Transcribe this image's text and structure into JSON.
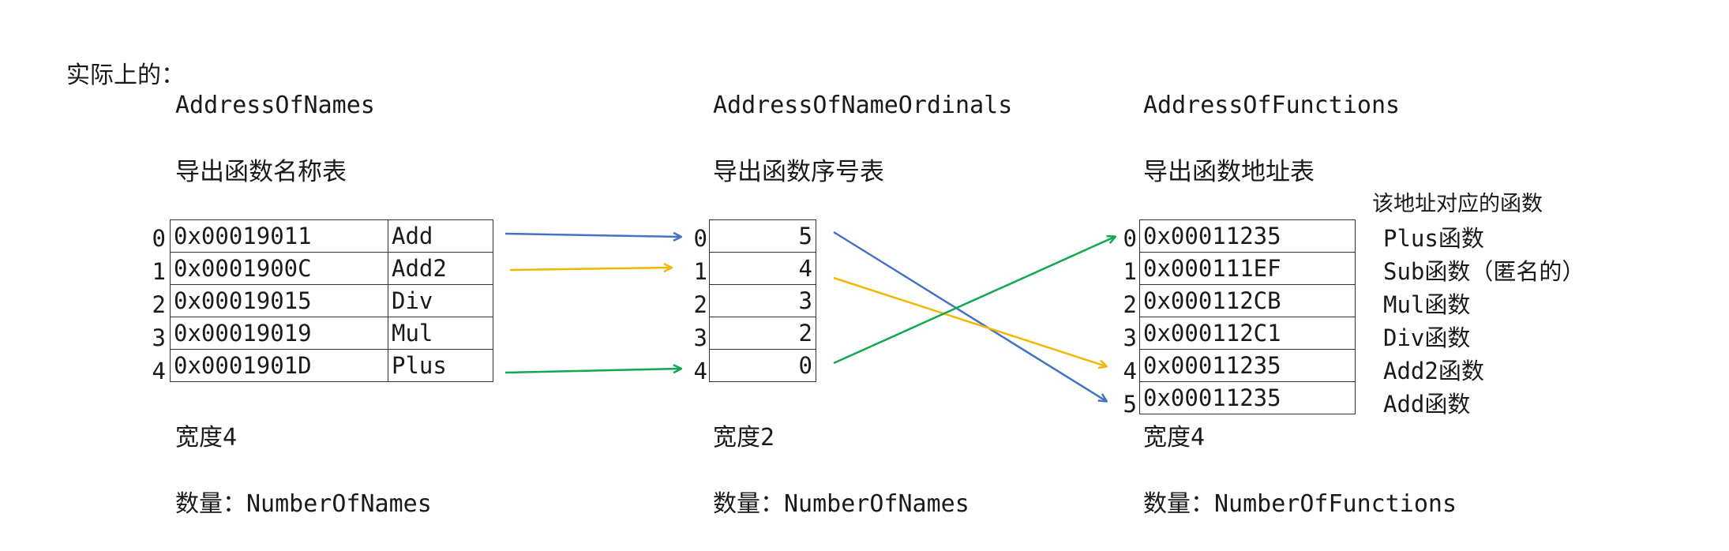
{
  "heading": "实际上的：",
  "names_table": {
    "title": "AddressOfNames",
    "subtitle": "导出函数名称表",
    "indices": [
      "0",
      "1",
      "2",
      "3",
      "4"
    ],
    "rows": [
      {
        "addr": "0x00019011",
        "name": "Add"
      },
      {
        "addr": "0x0001900C",
        "name": "Add2"
      },
      {
        "addr": "0x00019015",
        "name": "Div"
      },
      {
        "addr": "0x00019019",
        "name": "Mul"
      },
      {
        "addr": "0x0001901D",
        "name": "Plus"
      }
    ],
    "width_label": "宽度4",
    "count_label": "数量：NumberOfNames"
  },
  "ordinals_table": {
    "title": "AddressOfNameOrdinals",
    "subtitle": "导出函数序号表",
    "indices": [
      "0",
      "1",
      "2",
      "3",
      "4"
    ],
    "values": [
      "5",
      "4",
      "3",
      "2",
      "0"
    ],
    "width_label": "宽度2",
    "count_label": "数量：NumberOfNames"
  },
  "functions_table": {
    "title": "AddressOfFunctions",
    "subtitle": "导出函数地址表",
    "column_note": "该地址对应的函数",
    "indices": [
      "0",
      "1",
      "2",
      "3",
      "4",
      "5"
    ],
    "rows": [
      {
        "addr": "0x00011235",
        "func": "Plus函数"
      },
      {
        "addr": "0x000111EF",
        "func": "Sub函数（匿名的）"
      },
      {
        "addr": "0x000112CB",
        "func": "Mul函数"
      },
      {
        "addr": "0x000112C1",
        "func": "Div函数"
      },
      {
        "addr": "0x00011235",
        "func": "Add2函数"
      },
      {
        "addr": "0x00011235",
        "func": "Add函数"
      }
    ],
    "width_label": "宽度4",
    "count_label": "数量：NumberOfFunctions"
  },
  "arrow_colors": {
    "blue": "#4472c4",
    "yellow": "#f2b800",
    "green": "#11a84e"
  }
}
